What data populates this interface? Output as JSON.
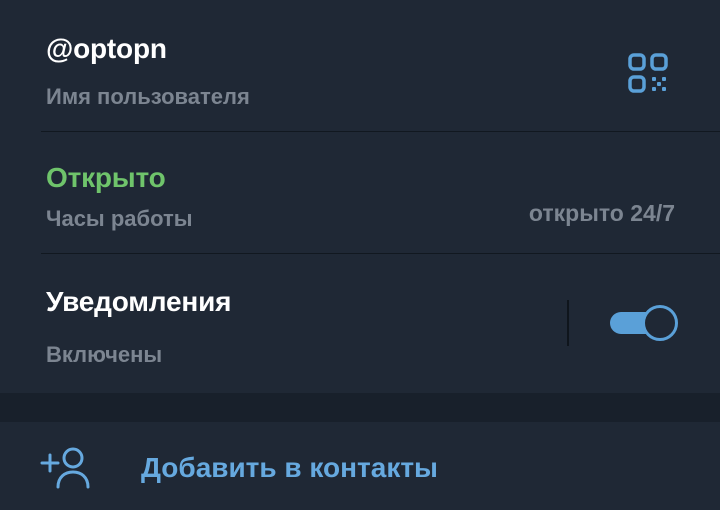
{
  "profile": {
    "username": "@optopn",
    "username_caption": "Имя пользователя",
    "qr_icon": "qr-code-icon"
  },
  "hours": {
    "status": "Открыто",
    "caption": "Часы работы",
    "value": "открыто 24/7"
  },
  "notifications": {
    "title": "Уведомления",
    "state": "Включены",
    "enabled": true
  },
  "actions": {
    "add_contact_label": "Добавить в контакты",
    "add_contact_icon": "add-user-icon"
  },
  "colors": {
    "background": "#1f2835",
    "accent": "#5aa0d8",
    "status_open": "#6fc46b",
    "muted_text": "#7c8591"
  }
}
